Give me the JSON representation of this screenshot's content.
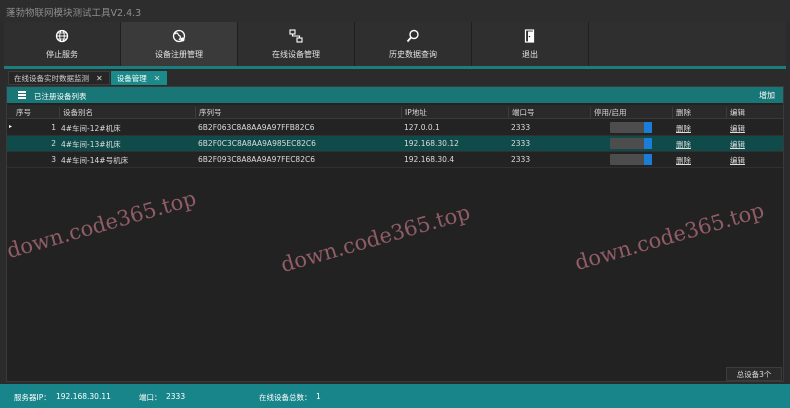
{
  "window": {
    "title": "蓬勃物联网模块测试工具V2.4.3"
  },
  "toolbar": {
    "buttons": [
      {
        "label": "停止服务",
        "icon": "globe-icon"
      },
      {
        "label": "设备注册管理",
        "icon": "globe-register-icon"
      },
      {
        "label": "在线设备管理",
        "icon": "network-icon"
      },
      {
        "label": "历史数据查询",
        "icon": "search-icon"
      },
      {
        "label": "退出",
        "icon": "exit-icon"
      }
    ],
    "active_index": 1
  },
  "tabs": [
    {
      "label": "在线设备实时数据监测",
      "close": "✕"
    },
    {
      "label": "设备管理",
      "close": "✕"
    }
  ],
  "panel": {
    "title": "已注册设备列表",
    "add_label": "增加",
    "columns": [
      "序号",
      "设备别名",
      "序列号",
      "IP地址",
      "端口号",
      "停用/启用",
      "删除",
      "编辑"
    ],
    "rows": [
      {
        "idx": "1",
        "alias": "4#车间-12#机床",
        "serial": "6B2F063C8A8AA9A97FFB82C6",
        "ip": "127.0.0.1",
        "port": "2333",
        "enabled": true,
        "delete": "删除",
        "edit": "编辑"
      },
      {
        "idx": "2",
        "alias": "4#车间-13#机床",
        "serial": "6B2F0C3C8A8AA9A985EC82C6",
        "ip": "192.168.30.12",
        "port": "2333",
        "enabled": true,
        "delete": "删除",
        "edit": "编辑"
      },
      {
        "idx": "3",
        "alias": "4#车间-14#号机床",
        "serial": "6B2F093C8A8AA9A97FEC82C6",
        "ip": "192.168.30.4",
        "port": "2333",
        "enabled": true,
        "delete": "删除",
        "edit": "编辑"
      }
    ],
    "selected_row": 1,
    "current_row_marker": "▸",
    "total_label": "总设备3个"
  },
  "status": {
    "server_ip_label": "服务器IP：",
    "server_ip": "192.168.30.11",
    "port_label": "端口：",
    "port": "2333",
    "online_label": "在线设备总数：",
    "online": "1"
  },
  "watermark": {
    "text": "down.code365.top"
  },
  "colors": {
    "accent": "#187676",
    "status_bar": "#18858a",
    "toggle_on": "#1a7ed8",
    "selected_row": "#0f4b4b"
  }
}
